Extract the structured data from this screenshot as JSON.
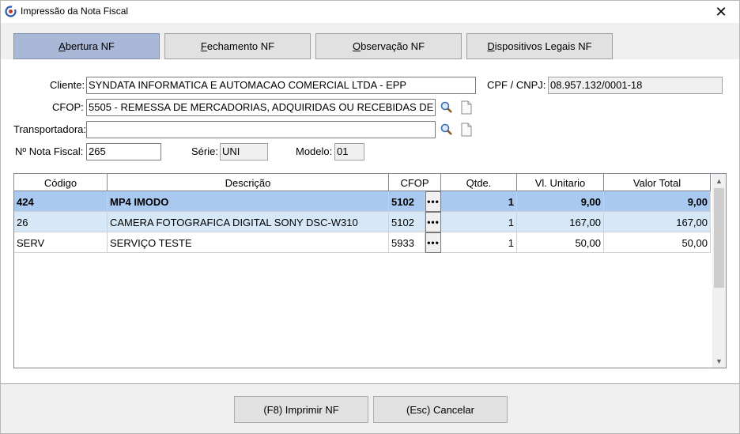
{
  "window": {
    "title": "Impressão da Nota Fiscal",
    "close_glyph": "✕"
  },
  "tabs": [
    {
      "prefix": "",
      "u": "A",
      "rest": "bertura NF"
    },
    {
      "prefix": "",
      "u": "F",
      "rest": "echamento NF"
    },
    {
      "prefix": "",
      "u": "O",
      "rest": "bservação NF"
    },
    {
      "prefix": "",
      "u": "D",
      "rest": "ispositivos Legais NF"
    }
  ],
  "form": {
    "cliente_label": "Cliente:",
    "cliente_value": "SYNDATA INFORMATICA E AUTOMACAO COMERCIAL LTDA - EPP",
    "cpf_label": "CPF / CNPJ:",
    "cpf_value": "08.957.132/0001-18",
    "cfop_label": "CFOP:",
    "cfop_value": "5505 - REMESSA DE MERCADORIAS, ADQUIRIDAS OU RECEBIDAS DE",
    "transportadora_label": "Transportadora:",
    "transportadora_value": "",
    "nota_label": "Nº Nota Fiscal:",
    "nota_value": "265",
    "serie_label": "Série:",
    "serie_value": "UNI",
    "modelo_label": "Modelo:",
    "modelo_value": "01"
  },
  "grid": {
    "headers": [
      "Código",
      "Descrição",
      "CFOP",
      "Qtde.",
      "Vl. Unitario",
      "Valor Total"
    ],
    "rows": [
      {
        "codigo": "424",
        "descricao": "MP4 IMODO",
        "cfop": "5102",
        "dots": "•••",
        "qtde": "1",
        "unit": "9,00",
        "total": "9,00"
      },
      {
        "codigo": "26",
        "descricao": "CAMERA FOTOGRAFICA DIGITAL SONY DSC-W310",
        "cfop": "5102",
        "dots": "•••",
        "qtde": "1",
        "unit": "167,00",
        "total": "167,00"
      },
      {
        "codigo": "SERV",
        "descricao": "SERVIÇO TESTE",
        "cfop": "5933",
        "dots": "•••",
        "qtde": "1",
        "unit": "50,00",
        "total": "50,00"
      }
    ],
    "scroll_up": "▲",
    "scroll_down": "▼"
  },
  "buttons": {
    "print": "(F8) Imprimir NF",
    "cancel": "(Esc) Cancelar"
  },
  "icons": {
    "app": "nf-app-icon",
    "search": "search-icon",
    "doc": "document-icon"
  },
  "colors": {
    "active_tab": "#a9b8d6",
    "selected_row": "#a9c9f0",
    "alt_row": "#d6e8f8"
  }
}
